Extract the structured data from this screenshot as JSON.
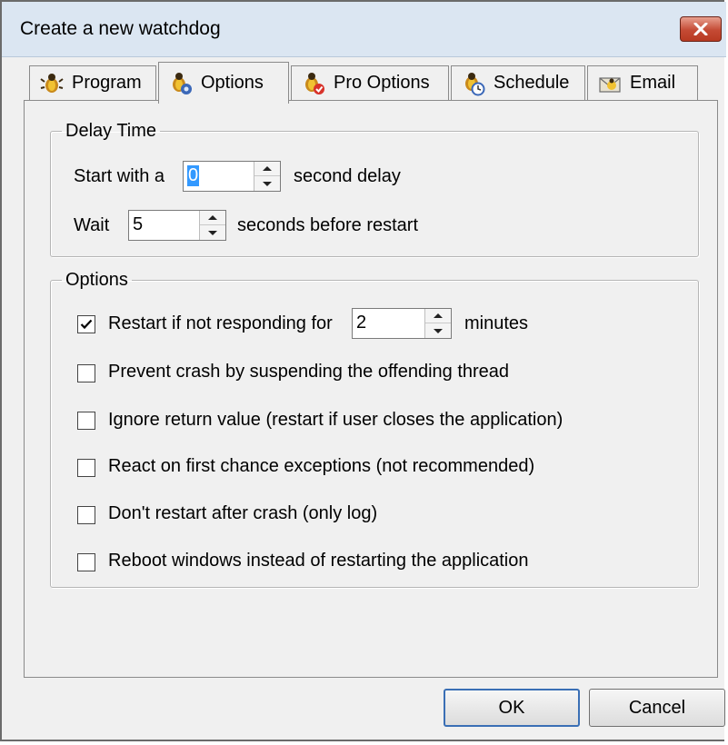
{
  "window": {
    "title": "Create a new watchdog"
  },
  "tabs": [
    {
      "label": "Program",
      "icon": "bug-icon",
      "active": false
    },
    {
      "label": "Options",
      "icon": "bug-gear-icon",
      "active": true
    },
    {
      "label": "Pro Options",
      "icon": "bug-check-icon",
      "active": false
    },
    {
      "label": "Schedule",
      "icon": "bug-clock-icon",
      "active": false
    },
    {
      "label": "Email",
      "icon": "envelope-icon",
      "active": false
    }
  ],
  "delay_group": {
    "legend": "Delay Time",
    "start_prefix": "Start with a",
    "start_value": "0",
    "start_suffix": "second delay",
    "wait_prefix": "Wait",
    "wait_value": "5",
    "wait_suffix": "seconds before restart"
  },
  "options_group": {
    "legend": "Options",
    "restart_label": "Restart if not responding for",
    "restart_value": "2",
    "restart_suffix": "minutes",
    "restart_checked": true,
    "items": [
      {
        "label": "Prevent crash by suspending the offending thread",
        "checked": false
      },
      {
        "label": "Ignore return value (restart if user closes the application)",
        "checked": false
      },
      {
        "label": "React on first chance exceptions (not recommended)",
        "checked": false
      },
      {
        "label": "Don't restart after crash (only log)",
        "checked": false
      },
      {
        "label": "Reboot windows instead of restarting the application",
        "checked": false
      }
    ]
  },
  "buttons": {
    "ok": "OK",
    "cancel": "Cancel"
  },
  "colors": {
    "title_bar": "#dbe6f2",
    "close_button": "#c44a34",
    "selection": "#3399ff"
  }
}
